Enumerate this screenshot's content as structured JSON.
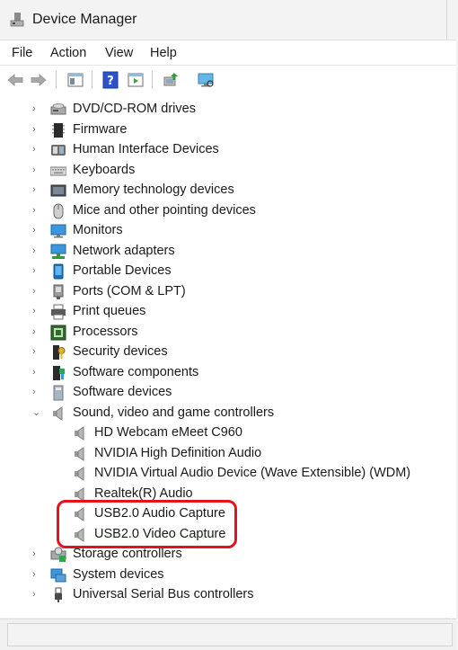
{
  "window": {
    "title": "Device Manager"
  },
  "menubar": {
    "items": [
      "File",
      "Action",
      "View",
      "Help"
    ]
  },
  "toolbar": {
    "buttons": [
      {
        "name": "back-arrow-icon"
      },
      {
        "name": "forward-arrow-icon"
      },
      {
        "name": "show-hide-console-tree-icon"
      },
      {
        "name": "help-icon"
      },
      {
        "name": "action-pane-icon"
      },
      {
        "name": "update-driver-icon"
      },
      {
        "name": "scan-hardware-changes-icon"
      }
    ]
  },
  "tree": {
    "items": [
      {
        "label": "DVD/CD-ROM drives",
        "icon": "dvd-drive-icon",
        "level": 0,
        "expanded": false
      },
      {
        "label": "Firmware",
        "icon": "firmware-chip-icon",
        "level": 0,
        "expanded": false
      },
      {
        "label": "Human Interface Devices",
        "icon": "hid-icon",
        "level": 0,
        "expanded": false
      },
      {
        "label": "Keyboards",
        "icon": "keyboard-icon",
        "level": 0,
        "expanded": false
      },
      {
        "label": "Memory technology devices",
        "icon": "memory-device-icon",
        "level": 0,
        "expanded": false
      },
      {
        "label": "Mice and other pointing devices",
        "icon": "mouse-icon",
        "level": 0,
        "expanded": false
      },
      {
        "label": "Monitors",
        "icon": "monitor-icon",
        "level": 0,
        "expanded": false
      },
      {
        "label": "Network adapters",
        "icon": "network-adapter-icon",
        "level": 0,
        "expanded": false
      },
      {
        "label": "Portable Devices",
        "icon": "portable-device-icon",
        "level": 0,
        "expanded": false
      },
      {
        "label": "Ports (COM & LPT)",
        "icon": "port-icon",
        "level": 0,
        "expanded": false
      },
      {
        "label": "Print queues",
        "icon": "printer-icon",
        "level": 0,
        "expanded": false
      },
      {
        "label": "Processors",
        "icon": "processor-icon",
        "level": 0,
        "expanded": false
      },
      {
        "label": "Security devices",
        "icon": "security-device-icon",
        "level": 0,
        "expanded": false
      },
      {
        "label": "Software components",
        "icon": "software-component-icon",
        "level": 0,
        "expanded": false
      },
      {
        "label": "Software devices",
        "icon": "software-device-icon",
        "level": 0,
        "expanded": false
      },
      {
        "label": "Sound, video and game controllers",
        "icon": "speaker-icon",
        "level": 0,
        "expanded": true
      },
      {
        "label": "HD Webcam eMeet C960",
        "icon": "speaker-icon",
        "level": 1
      },
      {
        "label": "NVIDIA High Definition Audio",
        "icon": "speaker-icon",
        "level": 1
      },
      {
        "label": "NVIDIA Virtual Audio Device (Wave Extensible) (WDM)",
        "icon": "speaker-icon",
        "level": 1
      },
      {
        "label": "Realtek(R) Audio",
        "icon": "speaker-icon",
        "level": 1
      },
      {
        "label": "USB2.0 Audio Capture",
        "icon": "speaker-icon",
        "level": 1
      },
      {
        "label": "USB2.0 Video Capture",
        "icon": "speaker-icon",
        "level": 1
      },
      {
        "label": "Storage controllers",
        "icon": "storage-controller-icon",
        "level": 0,
        "expanded": false
      },
      {
        "label": "System devices",
        "icon": "system-device-icon",
        "level": 0,
        "expanded": false
      },
      {
        "label": "Universal Serial Bus controllers",
        "icon": "usb-icon",
        "level": 0,
        "expanded": false
      }
    ]
  },
  "colors": {
    "highlight": "#e8111b",
    "window_bg": "#f3f3f3",
    "tree_bg": "#ffffff"
  }
}
